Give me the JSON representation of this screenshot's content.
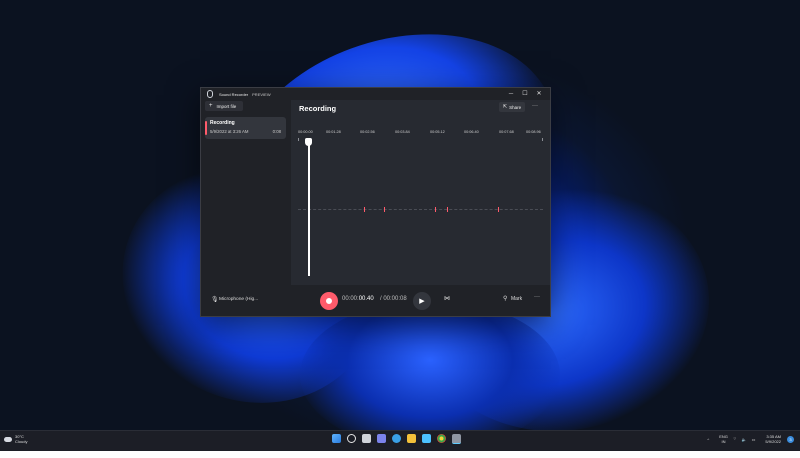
{
  "app": {
    "title": "Sound Recorder",
    "badge": "PREVIEW"
  },
  "window_controls": {
    "minimize": "─",
    "maximize": "☐",
    "close": "✕"
  },
  "sidebar": {
    "import_label": "Import file",
    "recordings": [
      {
        "name": "Recording",
        "date": "5/9/2022 at 3:26 AM",
        "duration": "0:08"
      }
    ]
  },
  "main": {
    "title": "Recording",
    "share_label": "Share",
    "ruler": [
      "00:00.00",
      "00:01.28",
      "00:02.56",
      "00:03.84",
      "00:05.12",
      "00:06.40",
      "00:07.68",
      "00:08.96"
    ]
  },
  "bottombar": {
    "mic_label": "Microphone (Hig...",
    "time_dim": "00:00:",
    "time_bright": "00.40",
    "time_total": "/ 00:00:08",
    "mark_label": "Mark"
  },
  "taskbar": {
    "temperature": "30°C",
    "weather": "Cloudy",
    "language": "ENG",
    "region": "IN",
    "time": "3:35 AM",
    "date": "5/9/2022",
    "notification_count": "3"
  }
}
